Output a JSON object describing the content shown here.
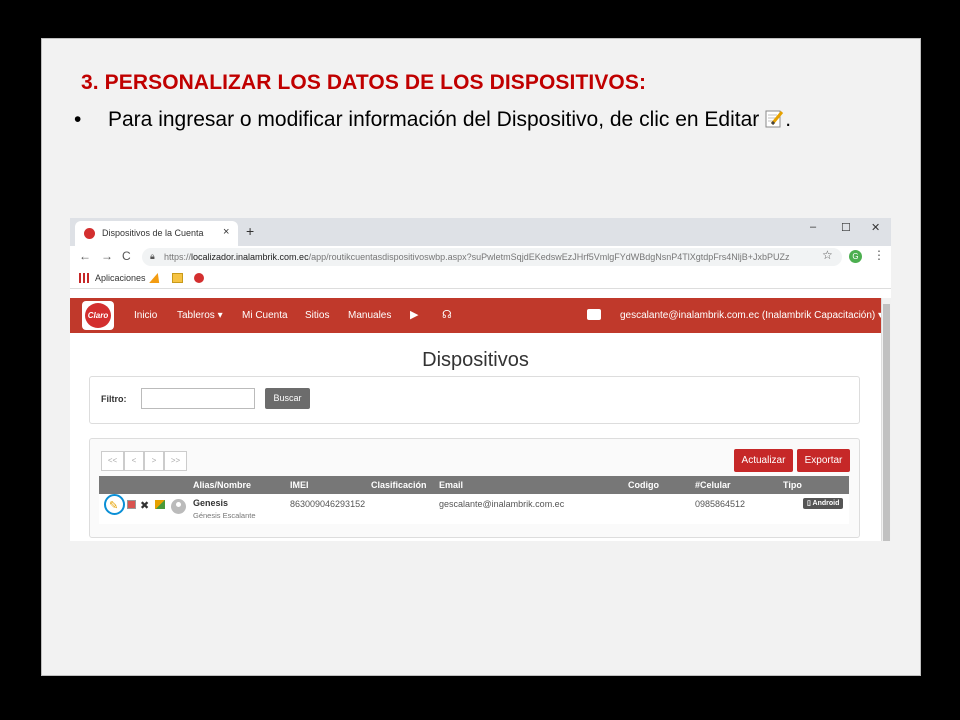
{
  "slide": {
    "title": "3. PERSONALIZAR LOS DATOS DE LOS DISPOSITIVOS:",
    "bullet_text": "Para ingresar o modificar información del Dispositivo, de clic en Editar",
    "bullet_end": "."
  },
  "browser": {
    "tab_title": "Dispositivos de la Cuenta",
    "tab_close": "×",
    "new_tab": "+",
    "win_minimize": "–",
    "win_maximize": "☐",
    "win_close": "✕",
    "back": "←",
    "forward": "→",
    "reload": "C",
    "url_scheme": "https://",
    "url_host": "localizador.inalambrik.com.ec",
    "url_path": "/app/routikcuentasdispositivoswbp.aspx?suPwletmSqjdEKedswEzJHrf5VmlgFYdWBdgNsnP4TlXgtdpFrs4NljB+JxbPUZz",
    "star": "☆",
    "profile_initial": "G",
    "kebab": "⋮",
    "bookmarks_label": "Aplicaciones"
  },
  "app": {
    "logo_text": "Claro",
    "nav": {
      "inicio": "Inicio",
      "tableros": "Tableros ▾",
      "mi_cuenta": "Mi Cuenta",
      "sitios": "Sitios",
      "manuales": "Manuales",
      "youtube_icon": "▶",
      "support_icon": "☊"
    },
    "user": "gescalante@inalambrik.com.ec (Inalambrik Capacitación) ▾",
    "heading": "Dispositivos",
    "filter": {
      "label": "Filtro:",
      "value": "",
      "search_button": "Buscar"
    },
    "pager": [
      "<<",
      "<",
      ">",
      ">>"
    ],
    "refresh_button": "Actualizar",
    "export_button": "Exportar",
    "columns": {
      "alias": "Alias/Nombre",
      "imei": "IMEI",
      "clasificacion": "Clasificación",
      "email": "Email",
      "codigo": "Codigo",
      "celular": "#Celular",
      "tipo": "Tipo"
    },
    "rows": [
      {
        "alias": "Genesis",
        "nombre": "Génesis Escalante",
        "imei": "863009046293152",
        "clasificacion": "",
        "email": "gescalante@inalambrik.com.ec",
        "codigo": "",
        "celular": "0985864512",
        "tipo": "▯ Android"
      }
    ],
    "row_actions": {
      "edit": "✎",
      "delete": "✖"
    }
  },
  "colors": {
    "title_red": "#c00000",
    "nav_red": "#c0392b",
    "highlight_blue": "#0a8fd6"
  }
}
